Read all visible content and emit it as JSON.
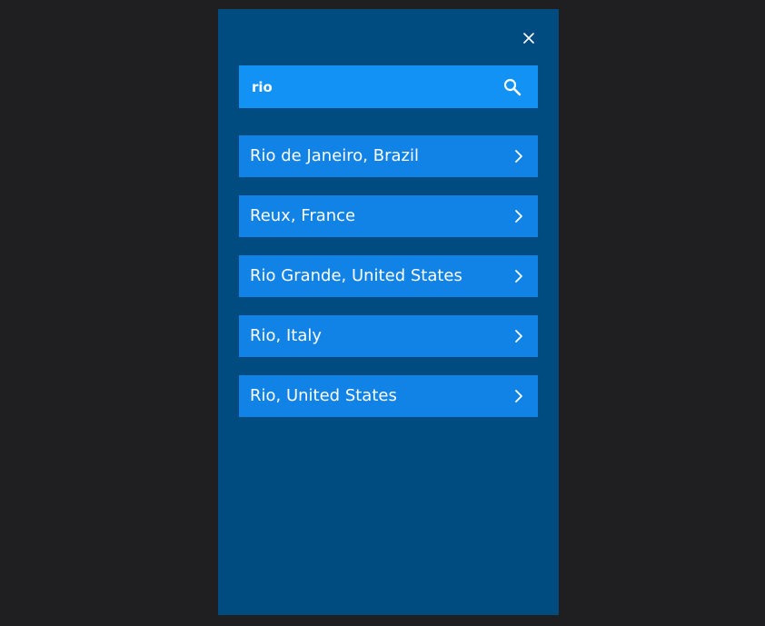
{
  "search": {
    "value": "rio",
    "placeholder": ""
  },
  "results": [
    {
      "label": "Rio de Janeiro, Brazil"
    },
    {
      "label": "Reux, France"
    },
    {
      "label": "Rio Grande, United States"
    },
    {
      "label": "Rio, Italy"
    },
    {
      "label": "Rio, United States"
    }
  ],
  "icons": {
    "close": "close-icon",
    "search": "search-icon",
    "chevron": "chevron-right-icon"
  },
  "colors": {
    "page_background": "#1f1f21",
    "panel_background": "#004b80",
    "search_background": "#1292f5",
    "result_background": "#1283e6",
    "text": "#ffffff"
  }
}
